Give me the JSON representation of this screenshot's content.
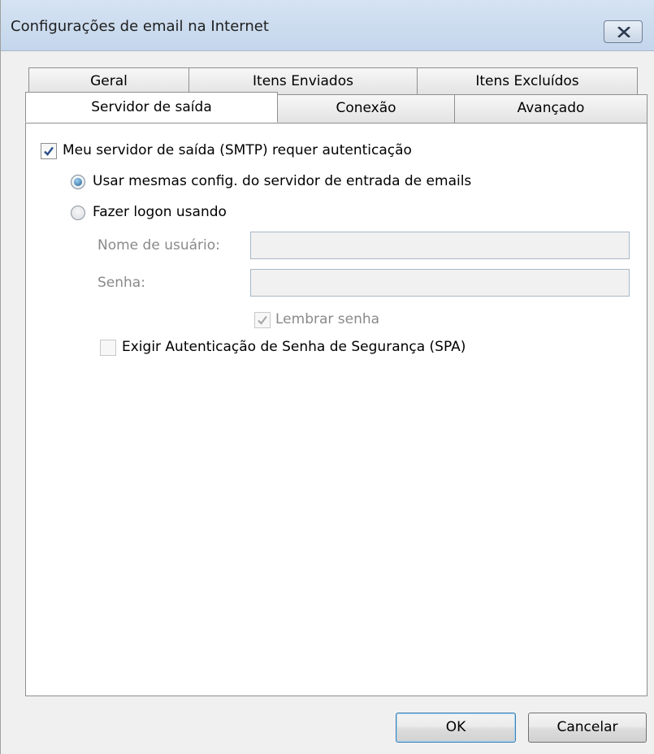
{
  "window": {
    "title": "Configurações de email na Internet"
  },
  "tabs": {
    "row1": [
      "Geral",
      "Itens Enviados",
      "Itens Excluídos"
    ],
    "row2": [
      "Servidor de saída",
      "Conexão",
      "Avançado"
    ],
    "active": "Servidor de saída"
  },
  "panel": {
    "smtp_auth_label": "Meu servidor de saída (SMTP) requer autenticação",
    "smtp_auth_checked": true,
    "radio_same_label": "Usar mesmas config. do servidor de entrada de emails",
    "radio_same_selected": true,
    "radio_logon_label": "Fazer logon usando",
    "radio_logon_selected": false,
    "username_label": "Nome de usuário:",
    "username_value": "",
    "password_label": "Senha:",
    "password_value": "",
    "remember_label": "Lembrar senha",
    "remember_checked": true,
    "spa_label": "Exigir Autenticação de Senha de Segurança (SPA)",
    "spa_checked": false
  },
  "buttons": {
    "ok": "OK",
    "cancel": "Cancelar"
  },
  "icons": {
    "close": "close-icon",
    "check": "checkmark-icon"
  }
}
